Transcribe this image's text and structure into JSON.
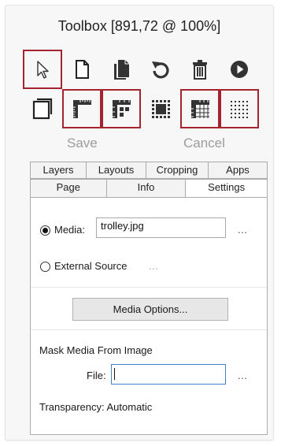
{
  "window": {
    "title": "Toolbox [891,72 @ 100%]"
  },
  "toolbar": {
    "row1": [
      {
        "icon": "pointer-icon",
        "selected": true
      },
      {
        "icon": "new-page-icon",
        "selected": false
      },
      {
        "icon": "copy-icon",
        "selected": false
      },
      {
        "icon": "undo-icon",
        "selected": false
      },
      {
        "icon": "trash-icon",
        "selected": false
      },
      {
        "icon": "play-icon",
        "selected": false
      }
    ],
    "row2": [
      {
        "icon": "duplicate-page-icon",
        "selected": false
      },
      {
        "icon": "ruler-corner-icon",
        "selected": true
      },
      {
        "icon": "ruler-grid-icon",
        "selected": true
      },
      {
        "icon": "dotted-square-icon",
        "selected": false
      },
      {
        "icon": "grid-ruler-icon",
        "selected": true
      },
      {
        "icon": "dot-grid-icon",
        "selected": true
      }
    ],
    "save_label": "Save",
    "cancel_label": "Cancel"
  },
  "tabs": {
    "row1": [
      "Layers",
      "Layouts",
      "Cropping",
      "Apps"
    ],
    "row2": [
      "Page",
      "Info",
      "Settings"
    ],
    "active": "Settings"
  },
  "settings": {
    "media_label": "Media:",
    "media_value": "trolley.jpg",
    "media_selected": true,
    "browse_label": "...",
    "external_label": "External Source",
    "external_dots": "...",
    "media_options_label": "Media Options...",
    "mask_heading": "Mask Media From Image",
    "file_label": "File:",
    "file_value": "",
    "file_browse_label": "...",
    "transparency_label": "Transparency: Automatic"
  },
  "colors": {
    "accent": "#a5232d",
    "focus": "#3f84c8"
  }
}
